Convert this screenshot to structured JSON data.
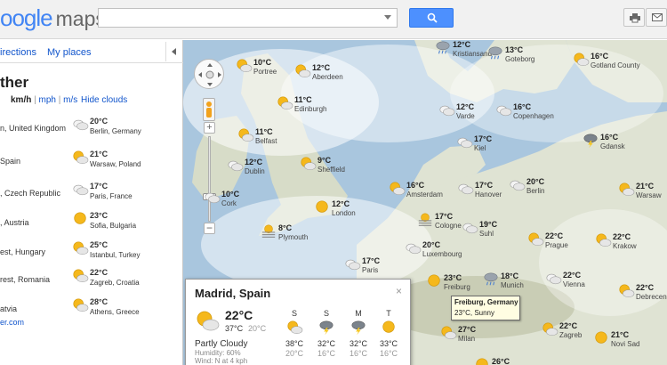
{
  "header": {
    "logo_text": "oogle",
    "logo_suffix": "maps",
    "search_value": "",
    "search_placeholder": ""
  },
  "panel": {
    "tabs": {
      "directions": "irections",
      "places": "My places"
    },
    "title": "ther",
    "units": {
      "kmh": "km/h",
      "mph": "mph",
      "ms": "m/s",
      "sep": "|"
    },
    "hide_clouds": "Hide clouds",
    "left_col": [
      {
        "place": "n, United Kingdom",
        "icon": "cloudy-icon"
      },
      {
        "place": "Spain",
        "icon": "partly-cloudy-icon"
      },
      {
        "place": ", Czech Republic",
        "icon": "cloudy-icon"
      },
      {
        "place": ", Austria",
        "icon": "sun-icon"
      },
      {
        "place": "est, Hungary",
        "icon": "partly-cloudy-icon"
      },
      {
        "place": "rest, Romania",
        "icon": "partly-cloudy-icon"
      },
      {
        "place": "atvia",
        "icon": "sun-icon"
      }
    ],
    "right_col": [
      {
        "temp": "20°C",
        "city": "Berlin, Germany",
        "icon": "cloudy-icon"
      },
      {
        "temp": "21°C",
        "city": "Warsaw, Poland",
        "icon": "partly-cloudy-icon"
      },
      {
        "temp": "17°C",
        "city": "Paris, France",
        "icon": "cloudy-icon"
      },
      {
        "temp": "23°C",
        "city": "Sofia, Bulgaria",
        "icon": "sun-icon"
      },
      {
        "temp": "25°C",
        "city": "Istanbul, Turkey",
        "icon": "partly-cloudy-icon"
      },
      {
        "temp": "22°C",
        "city": "Zagreb, Croatia",
        "icon": "partly-cloudy-icon"
      },
      {
        "temp": "28°C",
        "city": "Athens, Greece",
        "icon": "partly-cloudy-icon"
      }
    ],
    "footer_link": "er.com"
  },
  "map": {
    "markers": [
      {
        "temp": "12°C",
        "city": "Kristiansand",
        "icon": "rain-icon"
      },
      {
        "temp": "13°C",
        "city": "Goteborg",
        "icon": "rain-icon"
      },
      {
        "temp": "16°C",
        "city": "Gotland County",
        "icon": "partly-cloudy-icon"
      },
      {
        "temp": "10°C",
        "city": "Portree",
        "icon": "partly-cloudy-icon"
      },
      {
        "temp": "12°C",
        "city": "Aberdeen",
        "icon": "partly-cloudy-icon"
      },
      {
        "temp": "11°C",
        "city": "Edinburgh",
        "icon": "partly-cloudy-icon"
      },
      {
        "temp": "12°C",
        "city": "Varde",
        "icon": "cloudy-icon"
      },
      {
        "temp": "16°C",
        "city": "Copenhagen",
        "icon": "cloudy-icon"
      },
      {
        "temp": "11°C",
        "city": "Belfast",
        "icon": "partly-cloudy-icon"
      },
      {
        "temp": "17°C",
        "city": "Kiel",
        "icon": "cloudy-icon"
      },
      {
        "temp": "16°C",
        "city": "Gdansk",
        "icon": "storm-icon"
      },
      {
        "temp": "12°C",
        "city": "Dublin",
        "icon": "cloudy-icon"
      },
      {
        "temp": "9°C",
        "city": "Sheffield",
        "icon": "partly-cloudy-icon"
      },
      {
        "temp": "16°C",
        "city": "Amsterdam",
        "icon": "partly-cloudy-icon"
      },
      {
        "temp": "17°C",
        "city": "Hanover",
        "icon": "cloudy-icon"
      },
      {
        "temp": "20°C",
        "city": "Berlin",
        "icon": "cloudy-icon"
      },
      {
        "temp": "21°C",
        "city": "Warsaw",
        "icon": "partly-cloudy-icon"
      },
      {
        "temp": "10°C",
        "city": "Cork",
        "icon": "cloudy-icon"
      },
      {
        "temp": "12°C",
        "city": "London",
        "icon": "sun-icon"
      },
      {
        "temp": "17°C",
        "city": "Cologne",
        "icon": "fog-icon"
      },
      {
        "temp": "19°C",
        "city": "Suhl",
        "icon": "cloudy-icon"
      },
      {
        "temp": "8°C",
        "city": "Plymouth",
        "icon": "fog-icon"
      },
      {
        "temp": "22°C",
        "city": "Prague",
        "icon": "partly-cloudy-icon"
      },
      {
        "temp": "22°C",
        "city": "Krakow",
        "icon": "partly-cloudy-icon"
      },
      {
        "temp": "20°C",
        "city": "Luxembourg",
        "icon": "cloudy-icon"
      },
      {
        "temp": "17°C",
        "city": "Paris",
        "icon": "cloudy-icon"
      },
      {
        "temp": "23°C",
        "city": "Freiburg",
        "icon": "sun-icon"
      },
      {
        "temp": "18°C",
        "city": "Munich",
        "icon": "rain-icon"
      },
      {
        "temp": "22°C",
        "city": "Vienna",
        "icon": "cloudy-icon"
      },
      {
        "temp": "22°C",
        "city": "Debrecen",
        "icon": "partly-cloudy-icon"
      },
      {
        "temp": "27°C",
        "city": "Milan",
        "icon": "partly-cloudy-icon"
      },
      {
        "temp": "22°C",
        "city": "Zagreb",
        "icon": "partly-cloudy-icon"
      },
      {
        "temp": "21°C",
        "city": "Novi Sad",
        "icon": "sun-icon"
      },
      {
        "temp": "26°C",
        "city": "",
        "icon": "sun-icon"
      }
    ]
  },
  "info_window": {
    "title": "Madrid, Spain",
    "close": "×",
    "current_temp": "22°C",
    "high": "37°C",
    "low": "20°C",
    "condition": "Partly Cloudy",
    "humidity": "Humidity: 60%",
    "wind": "Wind: N at 4 kph",
    "forecast": [
      {
        "day": "S",
        "high": "38°C",
        "low": "20°C",
        "icon": "partly-cloudy-icon"
      },
      {
        "day": "S",
        "high": "32°C",
        "low": "16°C",
        "icon": "storm-icon"
      },
      {
        "day": "M",
        "high": "32°C",
        "low": "16°C",
        "icon": "storm-icon"
      },
      {
        "day": "T",
        "high": "33°C",
        "low": "16°C",
        "icon": "sun-icon"
      }
    ]
  },
  "tooltip": {
    "title": "Freiburg, Germany",
    "detail": "23°C, Sunny"
  },
  "colors": {
    "sun": "#f5b81c",
    "cloud": "#e6e6e6",
    "link": "#1155cc",
    "accent": "#4d90fe",
    "sea": "#a9c6de",
    "land": "#dfe3d3"
  }
}
